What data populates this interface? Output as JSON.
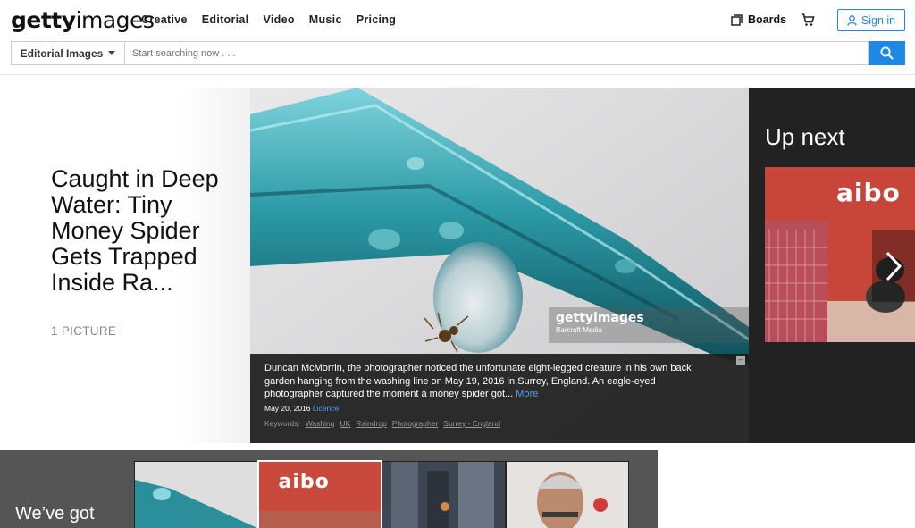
{
  "header": {
    "logo_bold": "getty",
    "logo_light": "images",
    "nav": [
      "Creative",
      "Editorial",
      "Video",
      "Music",
      "Pricing"
    ],
    "boards_label": "Boards",
    "signin_label": "Sign in"
  },
  "search": {
    "category": "Editorial Images",
    "placeholder": "Start searching now . . ."
  },
  "story": {
    "headline": "Caught in Deep Water: Tiny Money Spider Gets Trapped Inside Ra...",
    "picture_count": "1 PICTURE"
  },
  "photo": {
    "watermark_logo": "gettyimages",
    "watermark_credit": "Barcroft Media",
    "caption": "Duncan McMorrin, the photographer noticed the unfortunate eight-legged creature in his own back garden hanging from the washing line on May 19, 2016 in Surrey, England. An eagle-eyed photographer captured the moment a money spider got...",
    "more_label": "More",
    "date": "May 20, 2016",
    "licence_label": "Licence",
    "keywords_label": "Keywords:",
    "keywords": [
      "Washing",
      "UK",
      "Raindrop",
      "Photographer",
      "Surrey - England"
    ]
  },
  "up_next": {
    "title": "Up next",
    "thumb_text": "aibo"
  },
  "bottom": {
    "heading": "We’ve got",
    "thumb_text": "aibo"
  },
  "colors": {
    "accent": "#1e88e5",
    "dark_panel": "#222222",
    "band": "#555555"
  }
}
